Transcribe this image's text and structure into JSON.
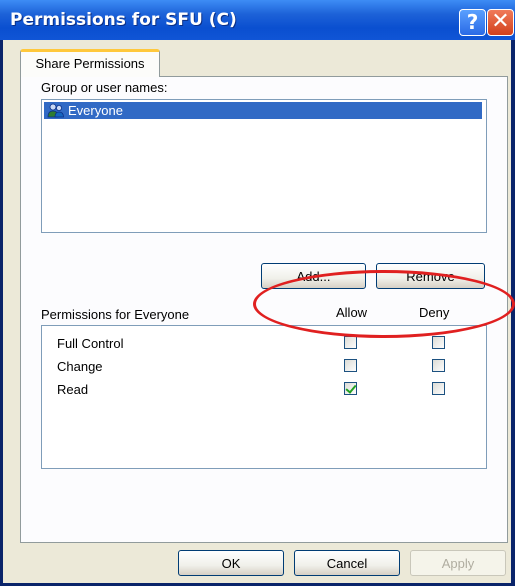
{
  "window": {
    "title": "Permissions for SFU (C)",
    "help_glyph": "?",
    "close_glyph": "✕"
  },
  "tabs": [
    {
      "label": "Share Permissions"
    }
  ],
  "group_list": {
    "label": "Group or user names:",
    "items": [
      {
        "name": "Everyone",
        "selected": true,
        "icon": "users-group-icon"
      }
    ]
  },
  "buttons": {
    "add": "Add...",
    "remove": "Remove",
    "ok": "OK",
    "cancel": "Cancel",
    "apply": "Apply"
  },
  "permissions": {
    "header": "Permissions for Everyone",
    "allow_label": "Allow",
    "deny_label": "Deny",
    "rows": [
      {
        "name": "Full Control",
        "allow": false,
        "deny": false
      },
      {
        "name": "Change",
        "allow": false,
        "deny": false
      },
      {
        "name": "Read",
        "allow": true,
        "deny": false
      }
    ]
  },
  "annotation": {
    "color": "#e02020"
  }
}
